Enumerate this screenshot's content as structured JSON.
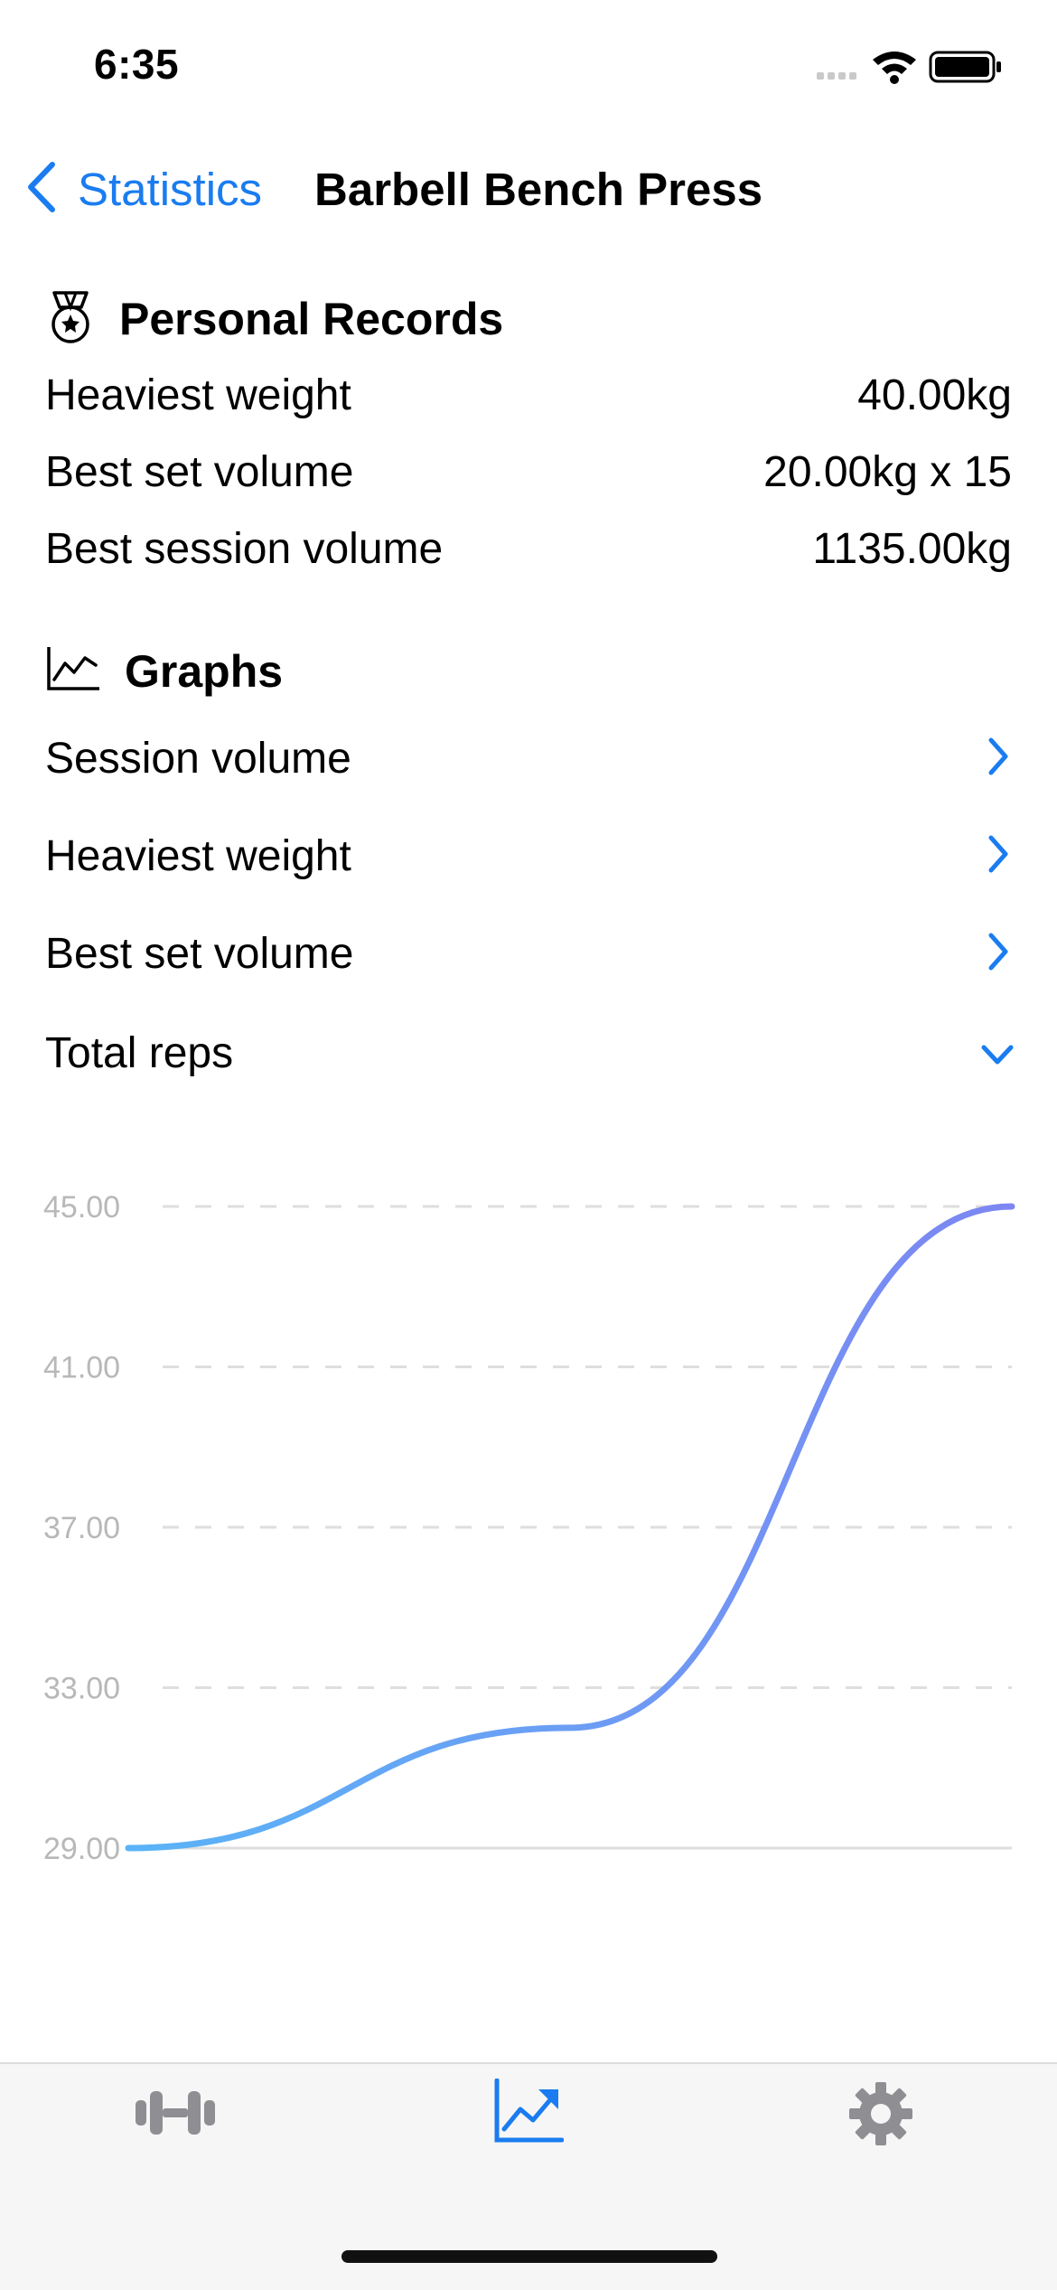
{
  "status_bar": {
    "time": "6:35"
  },
  "nav": {
    "back_label": "Statistics",
    "title": "Barbell Bench Press"
  },
  "records": {
    "title": "Personal Records",
    "rows": [
      {
        "label": "Heaviest weight",
        "value": "40.00kg"
      },
      {
        "label": "Best set volume",
        "value": "20.00kg x 15"
      },
      {
        "label": "Best session volume",
        "value": "1135.00kg"
      }
    ]
  },
  "graphs": {
    "title": "Graphs",
    "items": [
      {
        "label": "Session volume",
        "state": "collapsed"
      },
      {
        "label": "Heaviest weight",
        "state": "collapsed"
      },
      {
        "label": "Best set volume",
        "state": "collapsed"
      },
      {
        "label": "Total reps",
        "state": "expanded"
      }
    ]
  },
  "chart_data": {
    "type": "line",
    "title": "",
    "xlabel": "",
    "ylabel": "",
    "y_ticks": [
      "45.00",
      "41.00",
      "37.00",
      "33.00",
      "29.00"
    ],
    "ylim": [
      29,
      45
    ],
    "grid": "horizontal-dashed",
    "x": [
      1,
      2,
      3
    ],
    "values": [
      29,
      32,
      45
    ],
    "line_color_start": "#5ab4f7",
    "line_color_end": "#7d86f2"
  },
  "tabbar": {
    "tabs": [
      {
        "icon": "dumbbell-icon",
        "active": false
      },
      {
        "icon": "chart-line-icon",
        "active": true
      },
      {
        "icon": "gear-icon",
        "active": false
      }
    ]
  },
  "colors": {
    "accent": "#1a7cf0",
    "inactive_icon": "#8e8e93",
    "grid": "#dedede"
  }
}
